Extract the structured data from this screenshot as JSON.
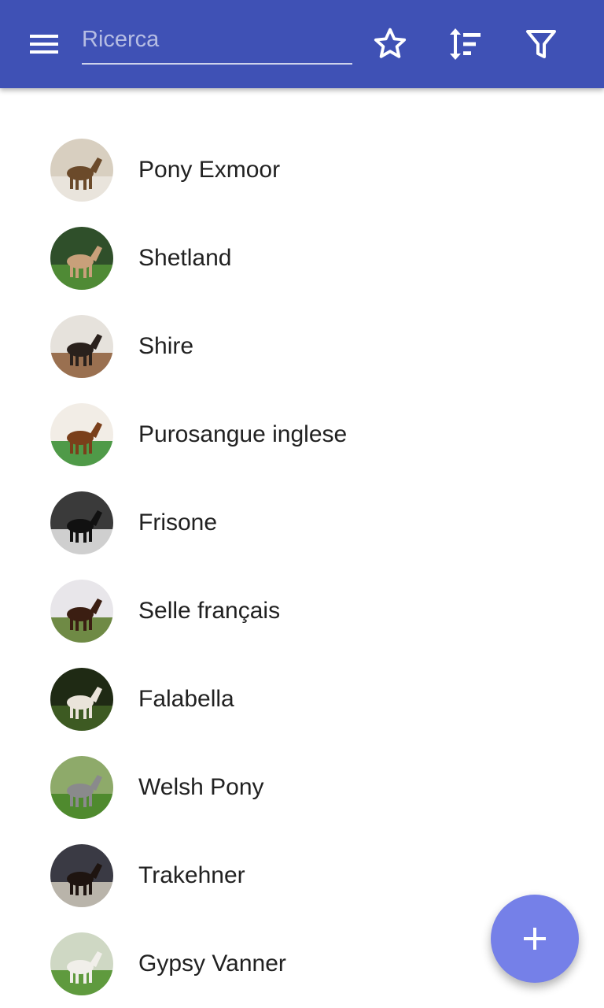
{
  "appbar": {
    "background_color": "#3f51b5",
    "menu_icon": "hamburger-menu-icon",
    "search": {
      "placeholder": "Ricerca",
      "value": ""
    },
    "actions": [
      {
        "icon": "star-outline-icon"
      },
      {
        "icon": "sort-icon"
      },
      {
        "icon": "filter-icon"
      }
    ]
  },
  "breeds": [
    {
      "name": "Pony Exmoor",
      "colors": {
        "sky": "#d8cfc0",
        "ground": "#e9e4dc",
        "horse": "#6b4a2a"
      }
    },
    {
      "name": "Shetland",
      "colors": {
        "sky": "#2f4f2a",
        "ground": "#4f8a35",
        "horse": "#c8a07a"
      }
    },
    {
      "name": "Shire",
      "colors": {
        "sky": "#e6e2dc",
        "ground": "#9a7050",
        "horse": "#2a211c"
      }
    },
    {
      "name": "Purosangue inglese",
      "colors": {
        "sky": "#f2ede6",
        "ground": "#4f9a48",
        "horse": "#7a3f1a"
      }
    },
    {
      "name": "Frisone",
      "colors": {
        "sky": "#3a3a3a",
        "ground": "#cfcfcf",
        "horse": "#111111"
      }
    },
    {
      "name": "Selle français",
      "colors": {
        "sky": "#e8e6ea",
        "ground": "#6f8a45",
        "horse": "#3b1e12"
      }
    },
    {
      "name": "Falabella",
      "colors": {
        "sky": "#1f2a14",
        "ground": "#3d5a22",
        "horse": "#eae4da"
      }
    },
    {
      "name": "Welsh Pony",
      "colors": {
        "sky": "#8eaa6a",
        "ground": "#4f8a2e",
        "horse": "#8a8a8c"
      }
    },
    {
      "name": "Trakehner",
      "colors": {
        "sky": "#3a3a44",
        "ground": "#b9b4aa",
        "horse": "#1e1410"
      }
    },
    {
      "name": "Gypsy Vanner",
      "colors": {
        "sky": "#cfd8c4",
        "ground": "#5f9a3e",
        "horse": "#f1efea"
      }
    }
  ],
  "fab": {
    "icon": "plus-icon",
    "color": "#7580e8"
  }
}
